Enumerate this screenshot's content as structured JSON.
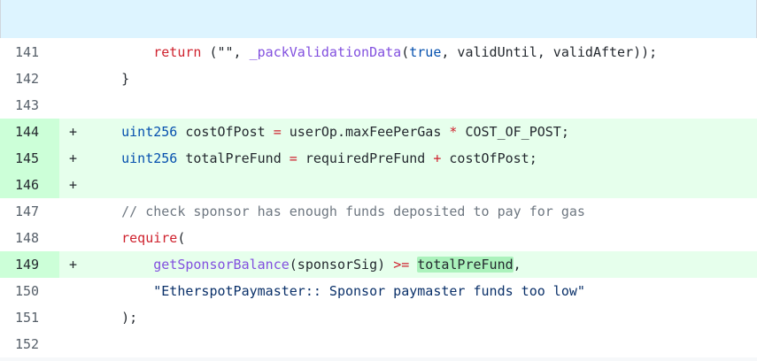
{
  "diff": {
    "lines": [
      {
        "num": "141",
        "marker": "",
        "added": false,
        "tokens": [
          {
            "t": "        ",
            "c": ""
          },
          {
            "t": "return",
            "c": "kw"
          },
          {
            "t": " (\"\", ",
            "c": ""
          },
          {
            "t": "_packValidationData",
            "c": "fn"
          },
          {
            "t": "(",
            "c": ""
          },
          {
            "t": "true",
            "c": "ty"
          },
          {
            "t": ", validUntil, validAfter));",
            "c": ""
          }
        ]
      },
      {
        "num": "142",
        "marker": "",
        "added": false,
        "tokens": [
          {
            "t": "    }",
            "c": ""
          }
        ]
      },
      {
        "num": "143",
        "marker": "",
        "added": false,
        "tokens": []
      },
      {
        "num": "144",
        "marker": "+",
        "added": true,
        "tokens": [
          {
            "t": "    ",
            "c": ""
          },
          {
            "t": "uint256",
            "c": "ty"
          },
          {
            "t": " costOfPost ",
            "c": ""
          },
          {
            "t": "=",
            "c": "op"
          },
          {
            "t": " userOp.maxFeePerGas ",
            "c": ""
          },
          {
            "t": "*",
            "c": "op"
          },
          {
            "t": " COST_OF_POST;",
            "c": ""
          }
        ]
      },
      {
        "num": "145",
        "marker": "+",
        "added": true,
        "tokens": [
          {
            "t": "    ",
            "c": ""
          },
          {
            "t": "uint256",
            "c": "ty"
          },
          {
            "t": " totalPreFund ",
            "c": ""
          },
          {
            "t": "=",
            "c": "op"
          },
          {
            "t": " requiredPreFund ",
            "c": ""
          },
          {
            "t": "+",
            "c": "op"
          },
          {
            "t": " costOfPost;",
            "c": ""
          }
        ]
      },
      {
        "num": "146",
        "marker": "+",
        "added": true,
        "tokens": []
      },
      {
        "num": "147",
        "marker": "",
        "added": false,
        "tokens": [
          {
            "t": "    ",
            "c": ""
          },
          {
            "t": "// check sponsor has enough funds deposited to pay for gas",
            "c": "cm"
          }
        ]
      },
      {
        "num": "148",
        "marker": "",
        "added": false,
        "tokens": [
          {
            "t": "    ",
            "c": ""
          },
          {
            "t": "require",
            "c": "kw"
          },
          {
            "t": "(",
            "c": ""
          }
        ]
      },
      {
        "num": "149",
        "marker": "+",
        "added": true,
        "tokens": [
          {
            "t": "        ",
            "c": ""
          },
          {
            "t": "getSponsorBalance",
            "c": "fn"
          },
          {
            "t": "(sponsorSig) ",
            "c": ""
          },
          {
            "t": ">=",
            "c": "op"
          },
          {
            "t": " ",
            "c": ""
          },
          {
            "t": "totalPreFund",
            "c": "hl"
          },
          {
            "t": ",",
            "c": ""
          }
        ]
      },
      {
        "num": "150",
        "marker": "",
        "added": false,
        "tokens": [
          {
            "t": "        ",
            "c": ""
          },
          {
            "t": "\"EtherspotPaymaster:: Sponsor paymaster funds too low\"",
            "c": "str"
          }
        ]
      },
      {
        "num": "151",
        "marker": "",
        "added": false,
        "tokens": [
          {
            "t": "    );",
            "c": ""
          }
        ]
      },
      {
        "num": "152",
        "marker": "",
        "added": false,
        "tokens": []
      }
    ]
  },
  "colors": {
    "added_row_bg": "#e6ffec",
    "added_gutter_bg": "#ccffd8",
    "hunk_header_bg": "#ddf4ff",
    "keyword": "#cf222e",
    "type": "#0550ae",
    "function": "#8250df",
    "comment": "#6e7781",
    "string": "#0a3069",
    "word_highlight": "#abf2bc"
  }
}
